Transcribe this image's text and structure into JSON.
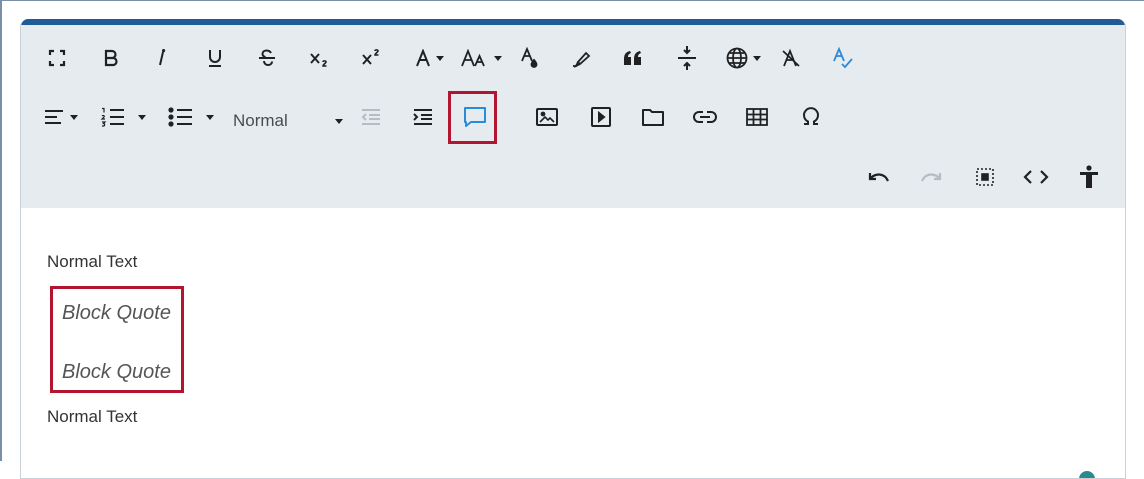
{
  "toolbar": {
    "format_select": {
      "value": "Normal"
    },
    "highlighted_button": "insert-quote-button"
  },
  "content": {
    "paragraphs": [
      {
        "type": "normal",
        "text": "Normal Text"
      },
      {
        "type": "blockquote",
        "text": "Block Quote"
      },
      {
        "type": "blockquote",
        "text": "Block Quote"
      },
      {
        "type": "normal",
        "text": "Normal Text"
      }
    ]
  },
  "colors": {
    "accent_bar": "#1f5b94",
    "toolbar_bg": "#e6ebf0",
    "highlight": "#b1152f",
    "active_icon": "#2a8bd8"
  }
}
